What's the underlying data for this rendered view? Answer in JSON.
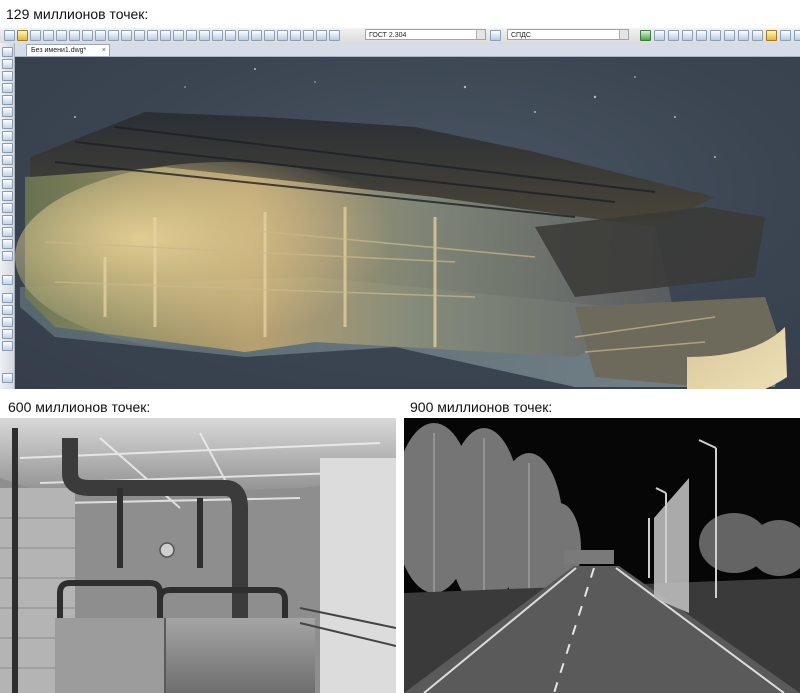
{
  "captions": {
    "top": "129 миллионов точек:",
    "bottom_left": "600 миллионов точек:",
    "bottom_right": "900 миллионов точек:"
  },
  "cad": {
    "style_combo": "ГОСТ 2.304",
    "style_combo2": "СПДС",
    "document_tab": "Без имени1.dwg*",
    "tab_close": "×"
  },
  "colors": {
    "viewport_bg": "#3d4754",
    "toolbar_bg": "#e3e3e3",
    "cloud_warm": "#d9b77a",
    "scan_gray": "#9a9a9a",
    "night_bg": "#060606"
  }
}
